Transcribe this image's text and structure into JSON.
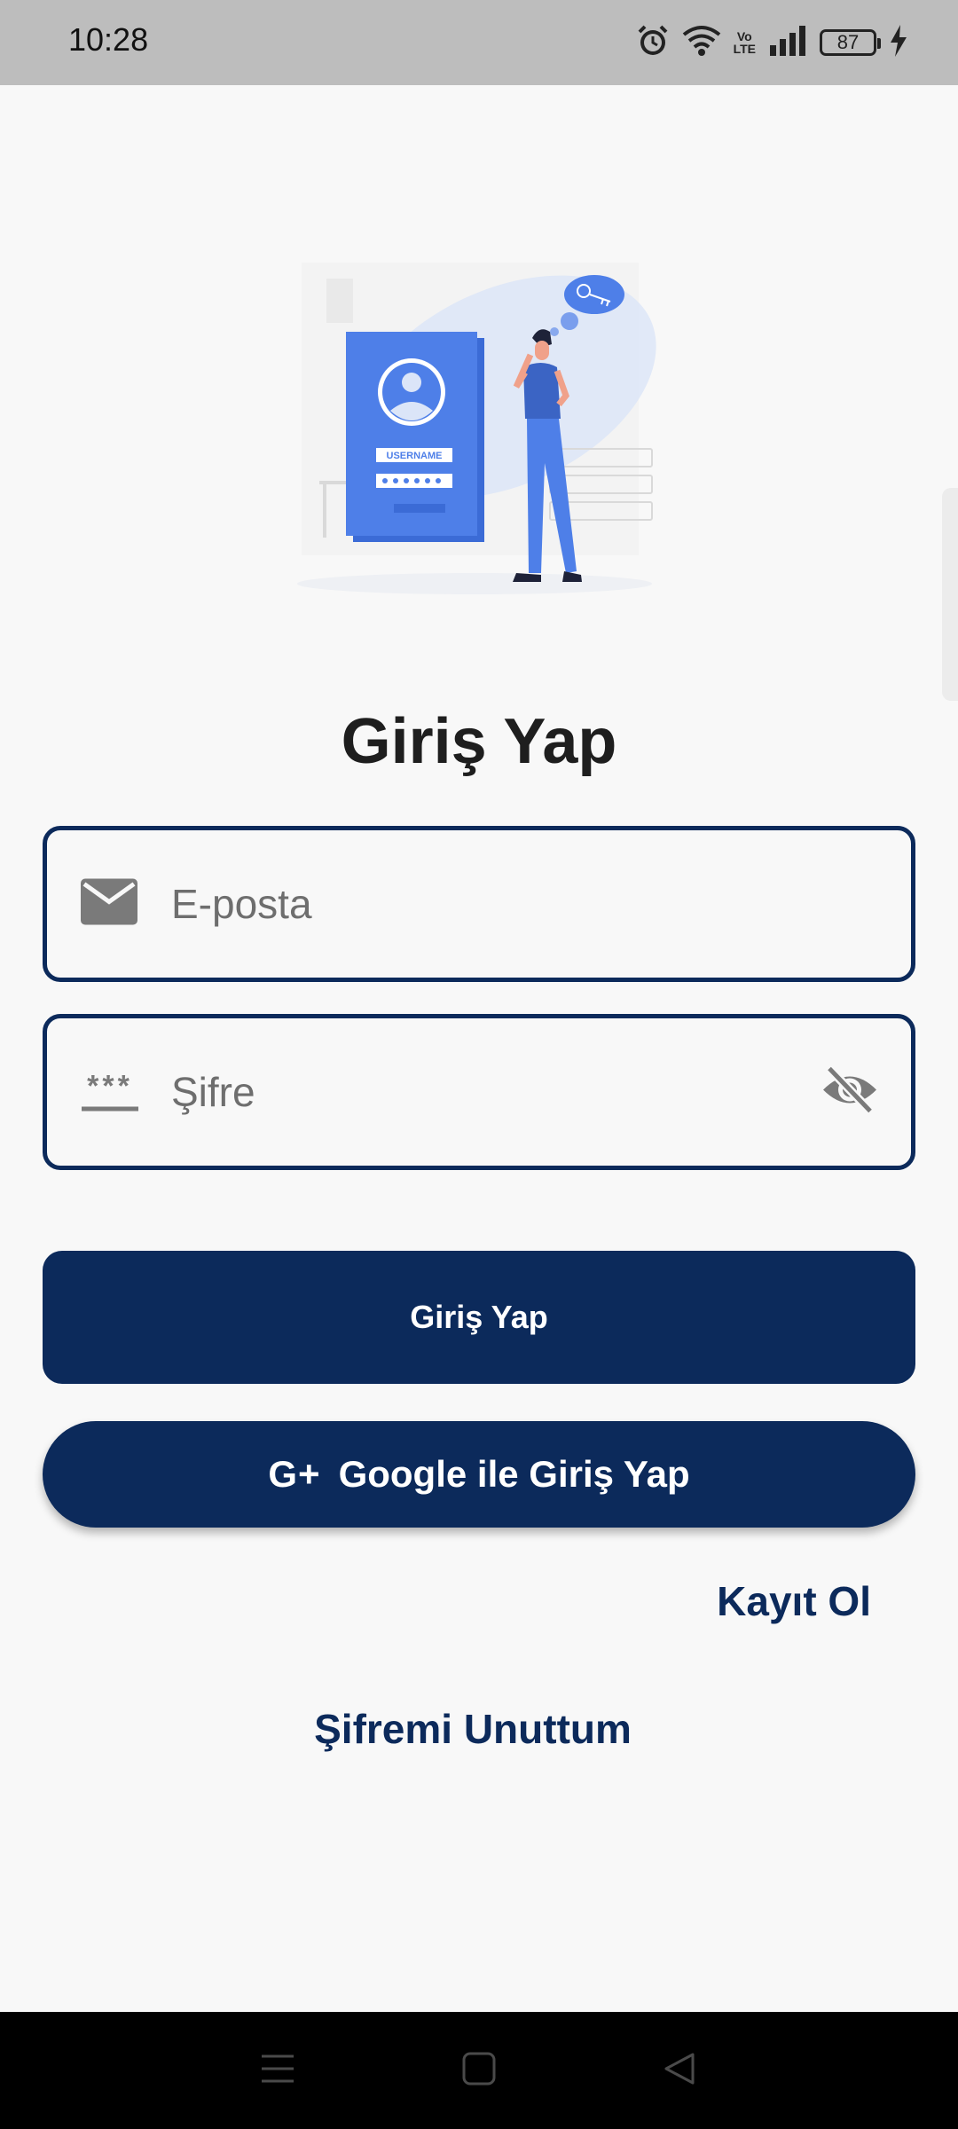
{
  "status_bar": {
    "time": "10:28",
    "volte_top": "Vo",
    "volte_bottom": "LTE",
    "battery": "87"
  },
  "icons": {
    "alarm": "alarm-icon",
    "wifi": "wifi-icon",
    "signal": "signal-icon",
    "charging": "charging-icon",
    "email": "envelope-icon",
    "password": "password-dots-icon",
    "visibility": "eye-off-icon",
    "nav_menu": "menu-icon",
    "nav_home": "square-icon",
    "nav_back": "triangle-back-icon"
  },
  "illustration": {
    "label_text": "USERNAME"
  },
  "login": {
    "title": "Giriş Yap",
    "email_placeholder": "E-posta",
    "password_placeholder": "Şifre",
    "password_icon_text": "***",
    "submit_label": "Giriş Yap",
    "google_icon_text": "G+",
    "google_label": "Google ile Giriş Yap",
    "register_label": "Kayıt Ol",
    "forgot_label": "Şifremi Unuttum"
  },
  "colors": {
    "primary": "#0c2a5b",
    "background": "#f8f8f8",
    "status_bar": "#bdbdbd",
    "illustration_blue": "#4e7fe8"
  }
}
